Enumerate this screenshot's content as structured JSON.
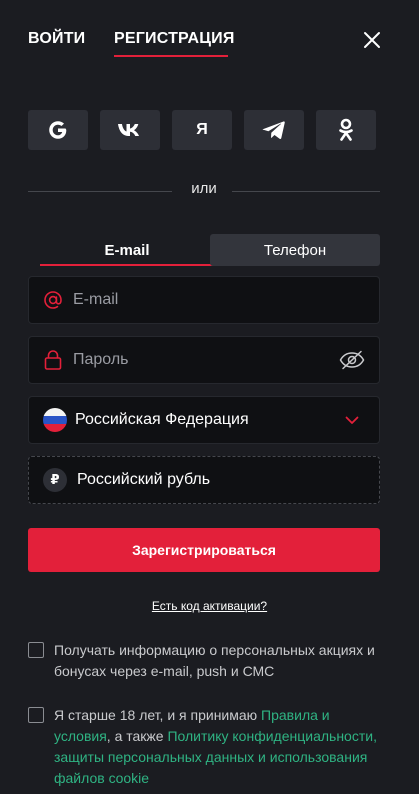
{
  "header": {
    "tab_login": "ВОЙТИ",
    "tab_register": "РЕГИСТРАЦИЯ"
  },
  "socials": [
    {
      "icon": "google-icon",
      "text": ""
    },
    {
      "icon": "vk-icon",
      "text": ""
    },
    {
      "icon": "yandex-icon",
      "text": "Я"
    },
    {
      "icon": "telegram-icon",
      "text": ""
    },
    {
      "icon": "odnoklassniki-icon",
      "text": ""
    }
  ],
  "divider": {
    "text": "или"
  },
  "method_tabs": {
    "email": "E-mail",
    "phone": "Телефон"
  },
  "fields": {
    "email_placeholder": "E-mail",
    "password_placeholder": "Пароль",
    "country_value": "Российская Федерация",
    "currency_value": "Российский рубль",
    "currency_symbol": "₽"
  },
  "submit_label": "Зарегистрироваться",
  "activation_link": "Есть код активации?",
  "consent": {
    "promo_text": "Получать информацию о персональных акциях и бонусах через e-mail, push и СМС",
    "age_prefix": "Я старше 18 лет, и я принимаю ",
    "age_link_rules": "Правила и условия",
    "age_middle": ", а также ",
    "age_link_policy": "Политику конфиденциальности, защиты персональных данных и использования файлов cookie"
  },
  "colors": {
    "background": "#1b1c21",
    "accent": "#e3203a",
    "link": "#2fb383",
    "button_dark": "#2d2f36"
  }
}
